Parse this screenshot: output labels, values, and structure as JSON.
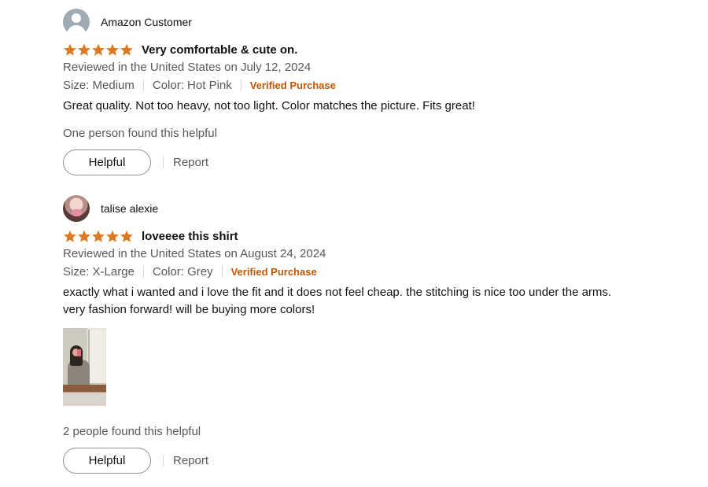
{
  "reviews": [
    {
      "reviewer_name": "Amazon Customer",
      "avatar": "default-user-icon",
      "rating": 5,
      "title": "Very comfortable & cute on.",
      "date_line": "Reviewed in the United States on July 12, 2024",
      "size": "Size: Medium",
      "color": "Color: Hot Pink",
      "verified": "Verified Purchase",
      "body": "Great quality. Not too heavy, not too light. Color matches the picture. Fits great!",
      "helpful_count_text": "One person found this helpful",
      "helpful_button": "Helpful",
      "report_link": "Report"
    },
    {
      "reviewer_name": "talise alexie",
      "avatar": "user-photo",
      "rating": 5,
      "title": "loveeee this shirt",
      "date_line": "Reviewed in the United States on August 24, 2024",
      "size": "Size: X-Large",
      "color": "Color: Grey",
      "verified": "Verified Purchase",
      "body_lines": [
        "exactly what i wanted and i love the fit and it does not feel cheap. the stitching is nice too under the arms.",
        "very fashion forward! will be buying more colors!"
      ],
      "media": "customer-photo-thumbnail",
      "helpful_count_text": "2 people found this helpful",
      "helpful_button": "Helpful",
      "report_link": "Report"
    }
  ],
  "colors": {
    "star": "#de7921",
    "verified": "#c45500",
    "secondary_text": "#565959",
    "primary_text": "#0f1111"
  }
}
